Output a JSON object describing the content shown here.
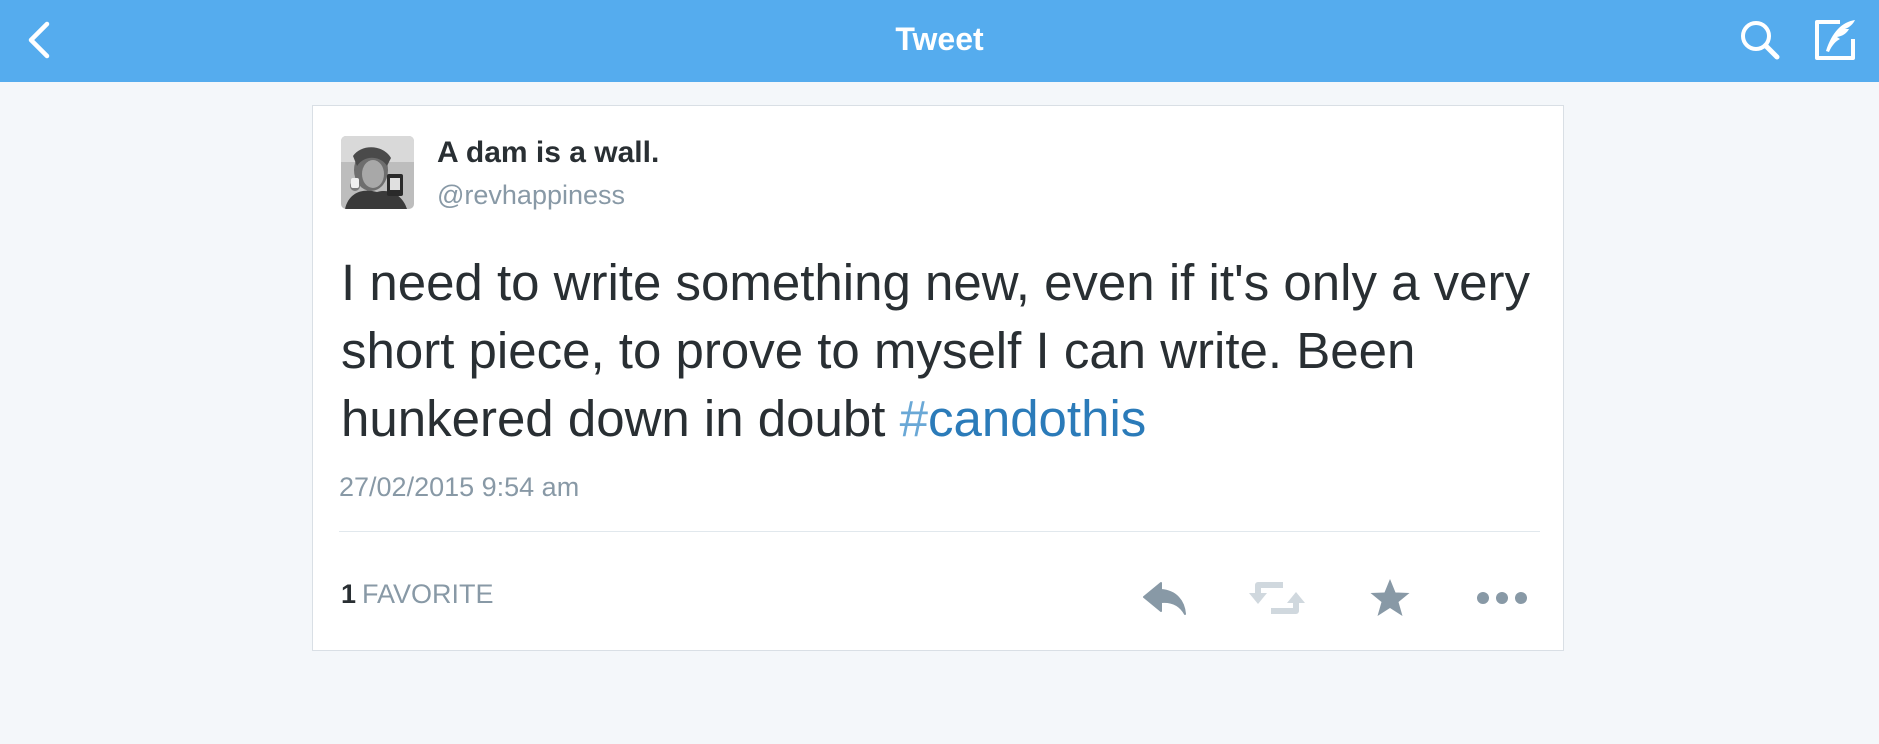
{
  "navbar": {
    "title": "Tweet",
    "background": "#55acee",
    "left_icon": "back-chevron",
    "right_icons": [
      "search",
      "compose"
    ]
  },
  "tweet": {
    "author": {
      "name": "A dam is a wall.",
      "handle": "@revhappiness",
      "avatar": "profile-photo-grayscale"
    },
    "text": "I need to write something new, even if it's only a very short piece, to prove to myself I can write. Been hunkered down in doubt ",
    "hashtag": {
      "hash": "#",
      "tag": "candothis"
    },
    "timestamp": "27/02/2015 9:54 am",
    "stats": {
      "count": "1",
      "label": "FAVORITE"
    },
    "actions": [
      "reply",
      "retweet",
      "favorite",
      "more"
    ]
  },
  "colors": {
    "brand": "#55acee",
    "link": "#2b7bb9",
    "muted": "#8899a6",
    "text": "#292f33",
    "background": "#f4f7fa"
  }
}
